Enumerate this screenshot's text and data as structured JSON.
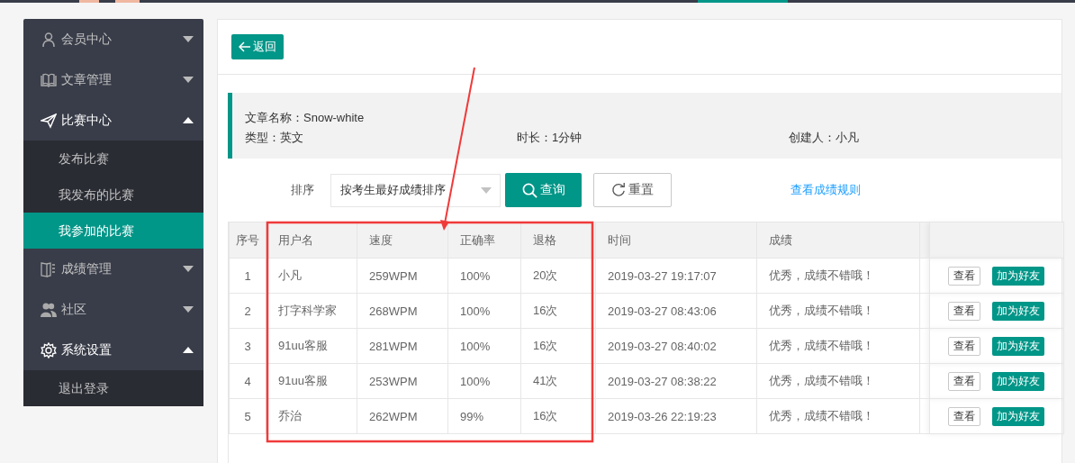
{
  "sidebar": {
    "items": [
      {
        "label": "会员中心",
        "expanded": false
      },
      {
        "label": "文章管理",
        "expanded": false
      },
      {
        "label": "比赛中心",
        "expanded": true,
        "children": [
          {
            "label": "发布比赛",
            "selected": false
          },
          {
            "label": "我发布的比赛",
            "selected": false
          },
          {
            "label": "我参加的比赛",
            "selected": true
          }
        ]
      },
      {
        "label": "成绩管理",
        "expanded": false
      },
      {
        "label": "社区",
        "expanded": false
      },
      {
        "label": "系统设置",
        "expanded": true,
        "children": [
          {
            "label": "退出登录",
            "selected": false
          }
        ]
      }
    ]
  },
  "back_button": "返回",
  "article": {
    "name": "文章名称：Snow-white",
    "type": "类型：英文",
    "duration": "时长：1分钟",
    "creator": "创建人：小凡"
  },
  "filter": {
    "label": "排序",
    "select_value": "按考生最好成绩排序",
    "query_button": "查询",
    "reset_button": "重置",
    "rules_link": "查看成绩规则"
  },
  "table": {
    "columns": [
      "序号",
      "用户名",
      "速度",
      "正确率",
      "退格",
      "时间",
      "成绩"
    ],
    "rows": [
      {
        "cells": [
          "1",
          "小凡",
          "259WPM",
          "100%",
          "20次",
          "2019-03-27 19:17:07",
          "优秀，成绩不错哦！"
        ],
        "actions": [
          "查看",
          "加为好友"
        ]
      },
      {
        "cells": [
          "2",
          "打字科学家",
          "268WPM",
          "100%",
          "16次",
          "2019-03-27 08:43:06",
          "优秀，成绩不错哦！"
        ],
        "actions": [
          "查看",
          "加为好友"
        ]
      },
      {
        "cells": [
          "3",
          "91uu客服",
          "281WPM",
          "100%",
          "16次",
          "2019-03-27 08:40:02",
          "优秀，成绩不错哦！"
        ],
        "actions": [
          "查看",
          "加为好友"
        ]
      },
      {
        "cells": [
          "4",
          "91uu客服",
          "253WPM",
          "100%",
          "41次",
          "2019-03-27 08:38:22",
          "优秀，成绩不错哦！"
        ],
        "actions": [
          "查看",
          "加为好友"
        ]
      },
      {
        "cells": [
          "5",
          "乔治",
          "262WPM",
          "99%",
          "16次",
          "2019-03-26 22:19:23",
          "优秀，成绩不错哦！"
        ],
        "actions": [
          "查看",
          "加为好友"
        ]
      }
    ]
  }
}
